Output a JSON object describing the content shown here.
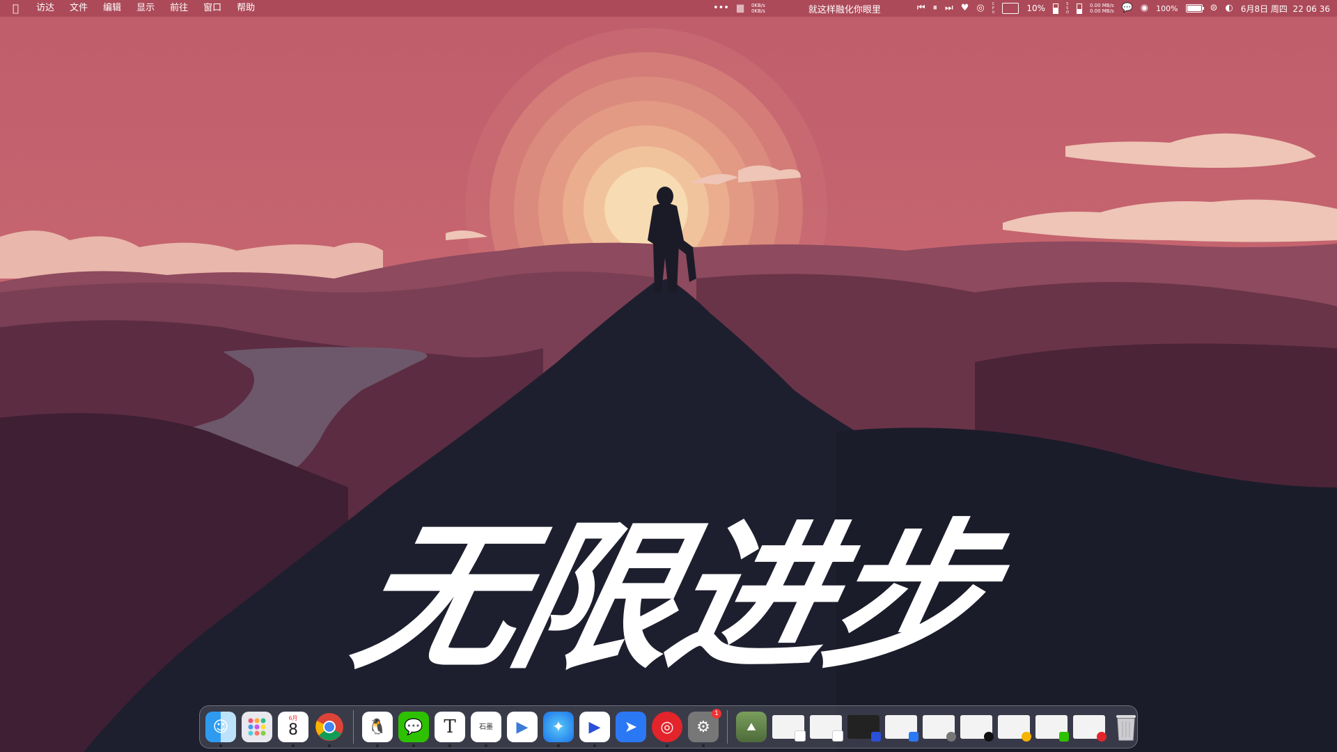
{
  "menubar": {
    "apple": "",
    "items": [
      "访达",
      "文件",
      "编辑",
      "显示",
      "前往",
      "窗口",
      "帮助"
    ],
    "more": "•••",
    "net_up": "0KB/s",
    "net_down": "0KB/s",
    "now_playing": "就这样融化你眼里",
    "cpu_label": "C\nP\nU",
    "cpu": "10%",
    "mem_label": "M\nE\nM",
    "ssd_label": "S\nS\nD",
    "disk_read": "0.00 MB/s",
    "disk_write": "0.00 MB/s",
    "battery": "100%",
    "datetime": "6月8日 周四  22 06 36"
  },
  "wallpaper": {
    "slogan": "无限进步"
  },
  "dock": {
    "calendar_month": "6月",
    "calendar_day": "8",
    "textedit": "T",
    "shimo": "石墨",
    "settings_badge": "1"
  },
  "colors": {
    "accent": "#c9636e",
    "menubar": "#a84856"
  }
}
